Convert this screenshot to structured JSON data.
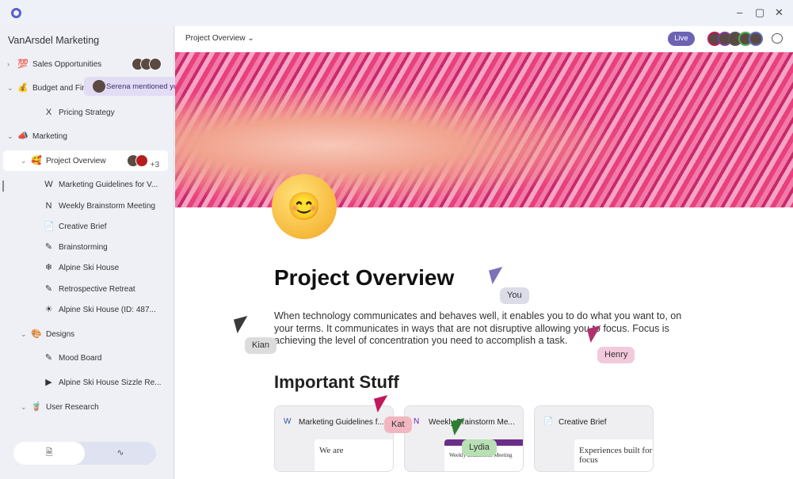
{
  "window": {
    "controls": [
      "–",
      "▢",
      "✕"
    ]
  },
  "sidebar": {
    "workspace": "VanArsdel Marketing",
    "items": [
      {
        "label": "Sales Opportunities",
        "icon": "💯"
      },
      {
        "label": "Budget and Fin",
        "icon": "💰"
      },
      {
        "label": "Pricing Strategy",
        "icon": "X"
      },
      {
        "label": "Marketing",
        "icon": "📣"
      },
      {
        "label": "Project Overview",
        "icon": "🥰",
        "extra": "+3"
      },
      {
        "label": "Marketing Guidelines for V...",
        "icon": "W"
      },
      {
        "label": "Weekly Brainstorm Meeting",
        "icon": "N"
      },
      {
        "label": "Creative Brief",
        "icon": "📄"
      },
      {
        "label": "Brainstorming",
        "icon": "✎"
      },
      {
        "label": "Alpine Ski House",
        "icon": "❄"
      },
      {
        "label": "Retrospective Retreat",
        "icon": "✎"
      },
      {
        "label": "Alpine Ski House (ID: 487...",
        "icon": "☀"
      },
      {
        "label": "Designs",
        "icon": "🎨"
      },
      {
        "label": "Mood Board",
        "icon": "✎"
      },
      {
        "label": "Alpine Ski House Sizzle Re...",
        "icon": "▶"
      },
      {
        "label": "User Research",
        "icon": "🧋"
      }
    ],
    "toast": "Serena mentioned you",
    "toggle": {
      "pages": "🗎",
      "activity": "∿"
    }
  },
  "header": {
    "breadcrumb": "Project Overview ⌄",
    "live": "Live"
  },
  "page": {
    "title": "Project Overview",
    "body": "When technology communicates and behaves well, it enables you to do what you want to, on your terms. It communicates in ways that are not disruptive allowing you to focus. Focus is achieving the level of concentration you need to accomplish a task.",
    "section": "Important Stuff",
    "cards": [
      {
        "title": "Marketing Guidelines f...",
        "icon": "W",
        "preview": "We are"
      },
      {
        "title": "Weekly Brainstorm Me...",
        "icon": "N",
        "preview": "Weekly Brainstorm Meeting"
      },
      {
        "title": "Creative Brief",
        "icon": "📄",
        "preview": "Experiences built for focus"
      }
    ]
  },
  "cursors": [
    {
      "name": "You",
      "color": "#7b72b8"
    },
    {
      "name": "Kian",
      "color": "#3a3a3a"
    },
    {
      "name": "Henry",
      "color": "#b0306e"
    },
    {
      "name": "Kat",
      "color": "#c2185b"
    },
    {
      "name": "Lydia",
      "color": "#2e7d32"
    }
  ]
}
